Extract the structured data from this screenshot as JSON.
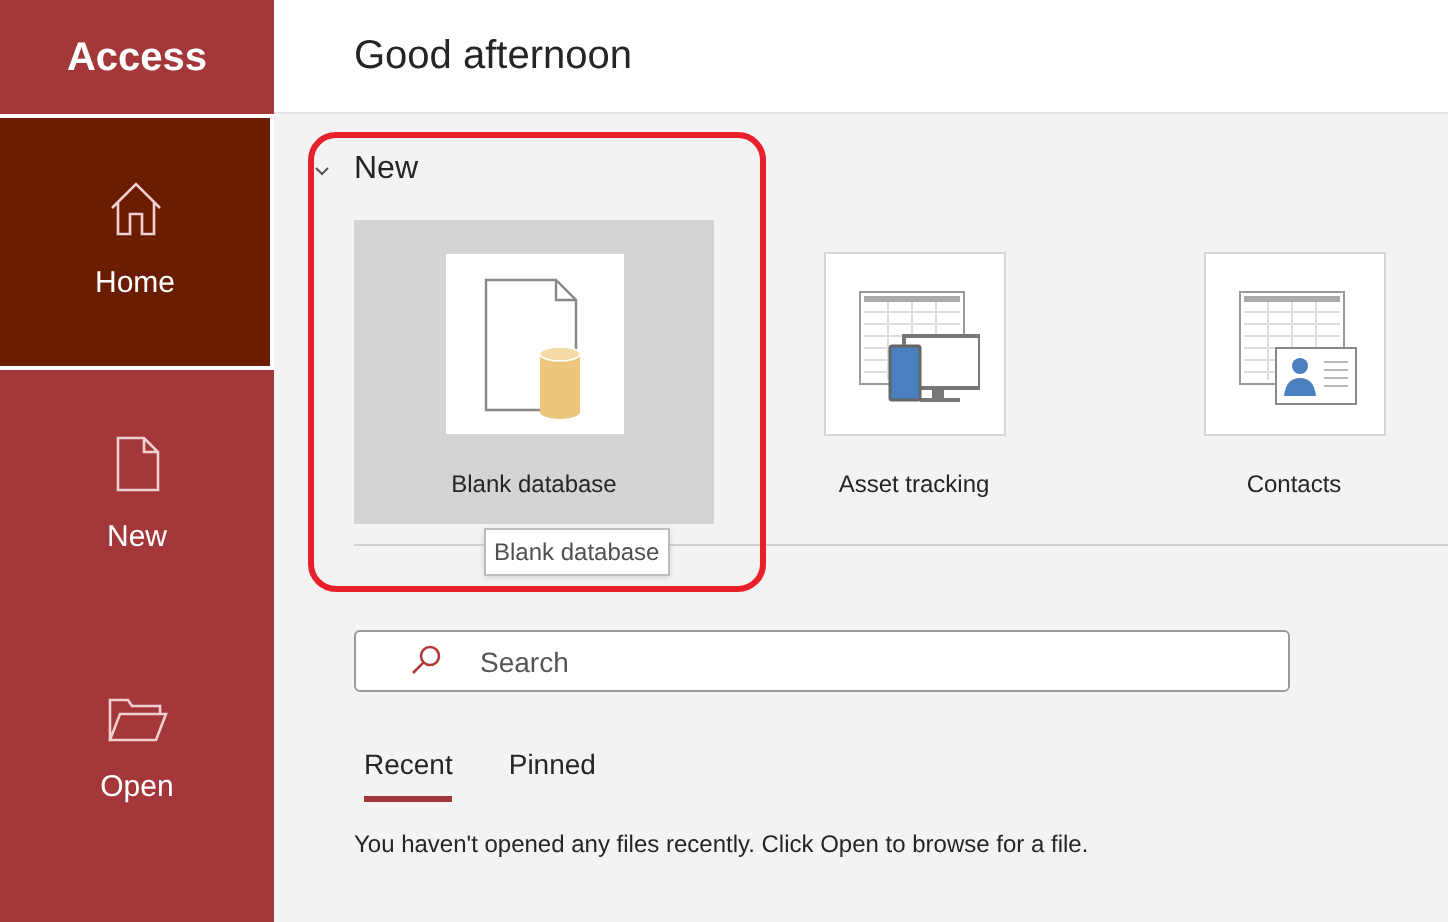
{
  "app": {
    "name": "Access"
  },
  "sidebar": {
    "items": [
      {
        "label": "Home",
        "kind": "home",
        "selected": true
      },
      {
        "label": "New",
        "kind": "new",
        "selected": false
      },
      {
        "label": "Open",
        "kind": "open",
        "selected": false
      }
    ]
  },
  "greeting": "Good afternoon",
  "new_section": {
    "title": "New",
    "expanded": true,
    "templates": [
      {
        "label": "Blank database",
        "kind": "blank",
        "selected": true
      },
      {
        "label": "Asset tracking",
        "kind": "asset",
        "selected": false
      },
      {
        "label": "Contacts",
        "kind": "contacts",
        "selected": false
      }
    ],
    "tooltip": "Blank database"
  },
  "search": {
    "placeholder": "Search"
  },
  "tabs": [
    {
      "label": "Recent",
      "selected": true
    },
    {
      "label": "Pinned",
      "selected": false
    }
  ],
  "message": "You haven't opened any files recently. Click Open to browse for a file."
}
